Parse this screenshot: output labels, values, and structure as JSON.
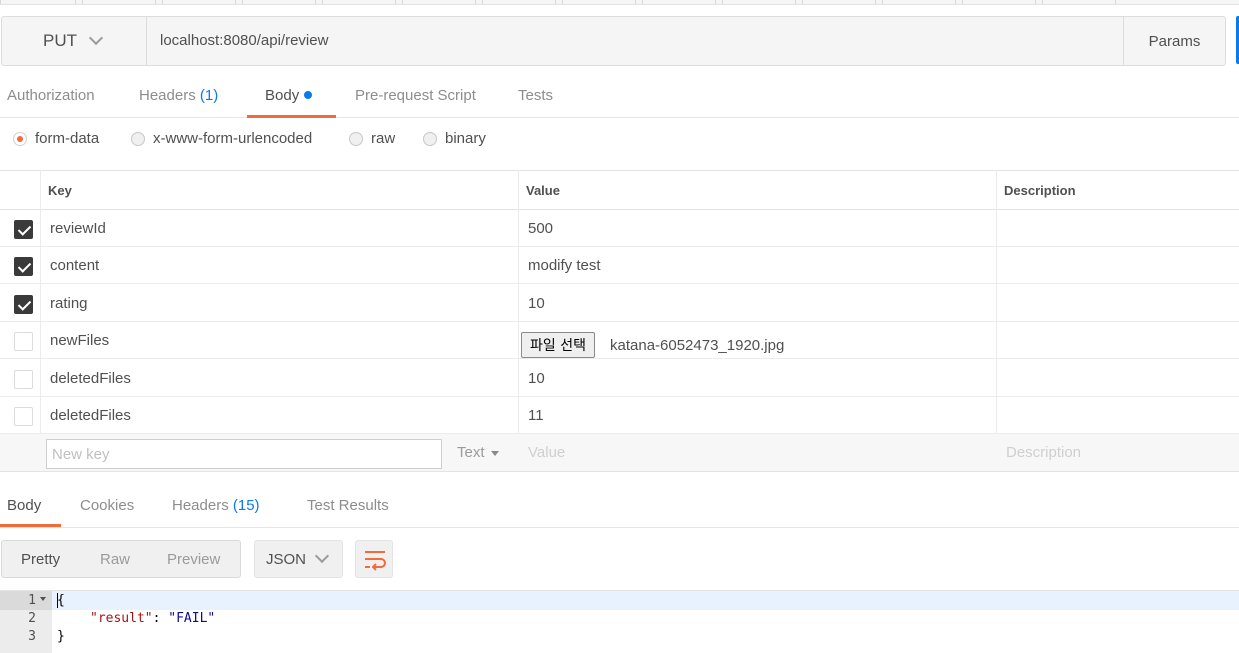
{
  "request": {
    "method": "PUT",
    "url": "localhost:8080/api/review",
    "params_label": "Params"
  },
  "request_tabs": [
    {
      "label": "Authorization"
    },
    {
      "label": "Headers",
      "count": "(1)"
    },
    {
      "label": "Body"
    },
    {
      "label": "Pre-request Script"
    },
    {
      "label": "Tests"
    }
  ],
  "body_types": [
    {
      "label": "form-data",
      "selected": true
    },
    {
      "label": "x-www-form-urlencoded",
      "selected": false
    },
    {
      "label": "raw",
      "selected": false
    },
    {
      "label": "binary",
      "selected": false
    }
  ],
  "form_table": {
    "headers": {
      "key": "Key",
      "value": "Value",
      "description": "Description"
    },
    "rows": [
      {
        "checked": true,
        "key": "reviewId",
        "value": "500"
      },
      {
        "checked": true,
        "key": "content",
        "value": "modify test"
      },
      {
        "checked": true,
        "key": "rating",
        "value": "10"
      },
      {
        "checked": false,
        "key": "newFiles",
        "file_button": "파일 선택",
        "file_name": "katana-6052473_1920.jpg"
      },
      {
        "checked": false,
        "key": "deletedFiles",
        "value": "10"
      },
      {
        "checked": false,
        "key": "deletedFiles",
        "value": "11"
      }
    ],
    "new_row": {
      "key_placeholder": "New key",
      "type": "Text",
      "value_placeholder": "Value",
      "description_placeholder": "Description"
    }
  },
  "response_tabs": [
    {
      "label": "Body"
    },
    {
      "label": "Cookies"
    },
    {
      "label": "Headers",
      "count": "(15)"
    },
    {
      "label": "Test Results"
    }
  ],
  "response_toolbar": {
    "views": [
      "Pretty",
      "Raw",
      "Preview"
    ],
    "active_view": "Pretty",
    "format": "JSON",
    "wrap_icon": "wrap-lines-icon"
  },
  "response_body": {
    "line_numbers": [
      "1",
      "2",
      "3"
    ],
    "open_brace": "{",
    "key": "\"result\"",
    "colon": ": ",
    "value": "\"FAIL\"",
    "close_brace": "}"
  },
  "colors": {
    "accent_orange": "#f26b3a",
    "accent_blue": "#097bed",
    "checkbox_dark": "#3a3a3a"
  }
}
